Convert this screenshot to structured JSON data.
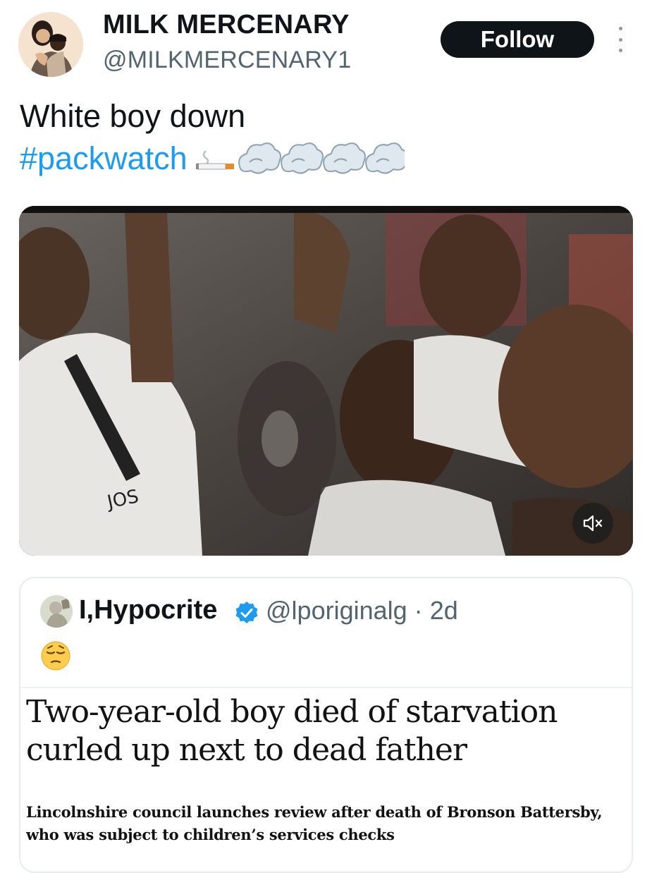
{
  "author": {
    "display_name": "MILK MERCENARY",
    "handle": "@MILKMERCENARY1",
    "avatar_icon": "profile-avatar-couple"
  },
  "follow_button": {
    "label": "Follow"
  },
  "tweet": {
    "line1": "White boy down",
    "hashtag": "#packwatch",
    "emojis": [
      "cigarette-emoji",
      "dash-emoji",
      "dash-emoji",
      "dash-emoji",
      "dash-emoji"
    ]
  },
  "media": {
    "description_icon": "video-thumbnail",
    "mute_icon": "speaker-muted-icon"
  },
  "quoted_tweet": {
    "display_name": "I,Hypocrite",
    "verified": true,
    "handle": "@lporiginalg",
    "separator": "·",
    "time": "2d",
    "emoji": "pensive-face-emoji",
    "article": {
      "headline": "Two-year-old boy died of starvation curled up next to dead father",
      "standfirst": "Lincolnshire council launches review after death of Bronson Battersby, who was subject to children’s services checks"
    }
  },
  "colors": {
    "link": "#1d9bf0",
    "text_primary": "#0f1419",
    "text_secondary": "#536471",
    "follow_bg": "#0f1419",
    "verified": "#1d9bf0"
  }
}
